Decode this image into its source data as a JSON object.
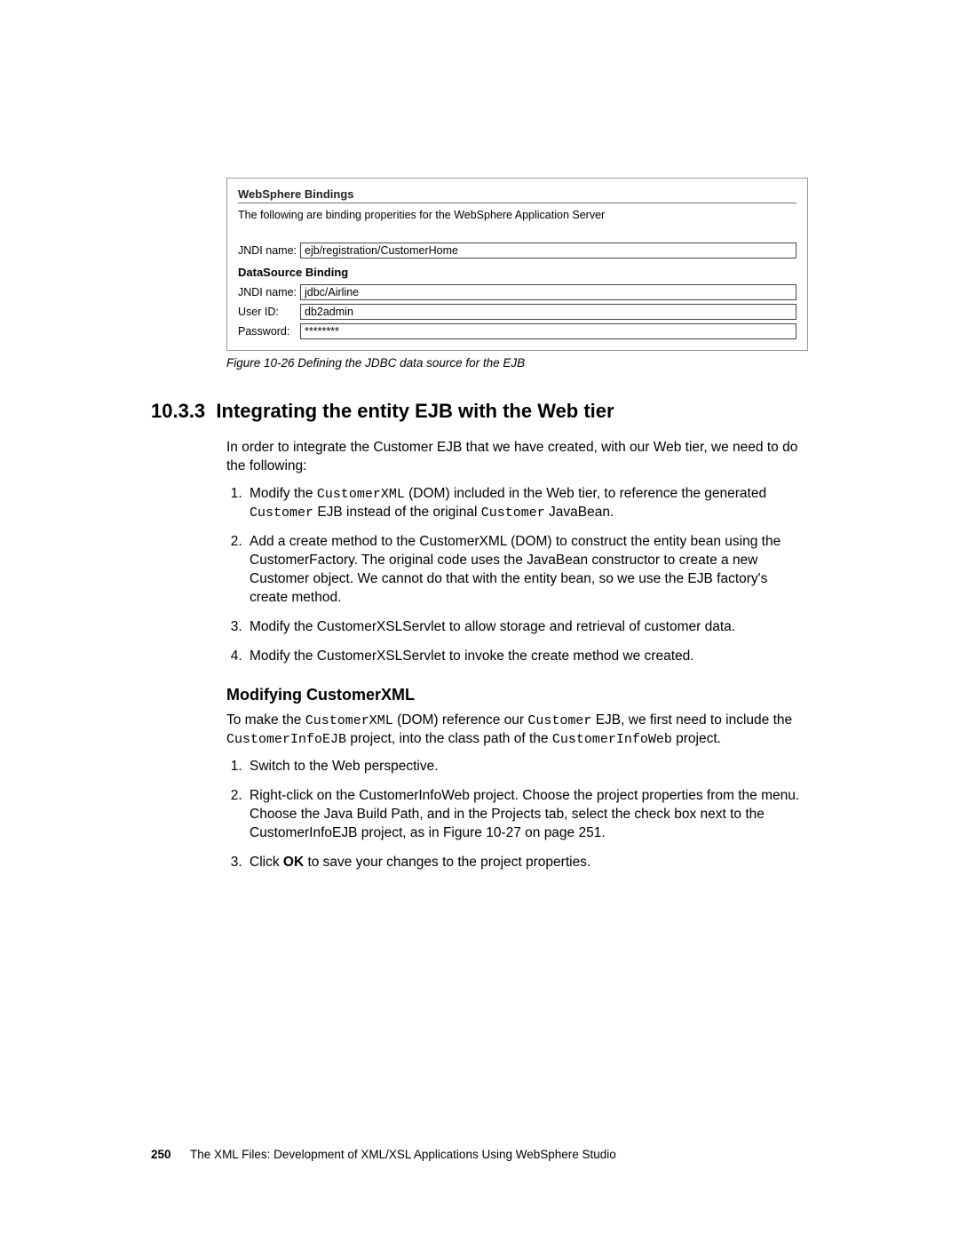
{
  "figure": {
    "bindings_heading": "WebSphere Bindings",
    "bindings_desc": "The following are binding properities for the WebSphere Application Server",
    "jndi_label": "JNDI name:",
    "jndi_value": "ejb/registration/CustomerHome",
    "ds_heading": "DataSource Binding",
    "ds_jndi_label": "JNDI name:",
    "ds_jndi_value": "jdbc/Airline",
    "user_label": "User ID:",
    "user_value": "db2admin",
    "pass_label": "Password:",
    "pass_value": "********",
    "caption_prefix": "Figure 10-26   ",
    "caption_text": "Defining the JDBC data source for the EJB"
  },
  "section": {
    "number": "10.3.3",
    "title": "Integrating the entity EJB with the Web tier",
    "intro": "In order to integrate the Customer EJB that we have created, with our Web tier, we need to do the following:"
  },
  "steps": {
    "s1_pre": "Modify the ",
    "s1_code1": "CustomerXML",
    "s1_mid1": " (DOM) included in the Web tier, to reference the generated ",
    "s1_code2": "Customer",
    "s1_mid2": " EJB instead of the original ",
    "s1_code3": "Customer",
    "s1_post": " JavaBean.",
    "s2": "Add a create method to the CustomerXML (DOM) to construct the entity bean using the CustomerFactory. The original code uses the JavaBean constructor to create a new Customer object. We cannot do that with the entity bean, so we use the EJB factory's create method.",
    "s3": "Modify the CustomerXSLServlet to allow storage and retrieval of customer data.",
    "s4": "Modify the CustomerXSLServlet to invoke the create method we created."
  },
  "sub": {
    "heading": "Modifying CustomerXML",
    "p_pre": "To make the ",
    "p_code1": "CustomerXML",
    "p_mid1": " (DOM) reference our ",
    "p_code2": "Customer",
    "p_mid2": " EJB, we first need to include the ",
    "p_code3": "CustomerInfoEJB",
    "p_mid3": " project, into the class path of the ",
    "p_code4": "CustomerInfoWeb",
    "p_post": " project."
  },
  "substeps": {
    "s1": "Switch to the Web perspective.",
    "s2": "Right-click on the CustomerInfoWeb project. Choose the project properties from the menu. Choose the Java Build Path, and in the Projects tab, select the check box next to the CustomerInfoEJB project, as in Figure 10-27 on page 251.",
    "s3_pre": "Click ",
    "s3_bold": "OK",
    "s3_post": " to save your changes to the project properties."
  },
  "footer": {
    "page": "250",
    "title": "The XML Files:   Development of XML/XSL Applications Using WebSphere Studio"
  }
}
